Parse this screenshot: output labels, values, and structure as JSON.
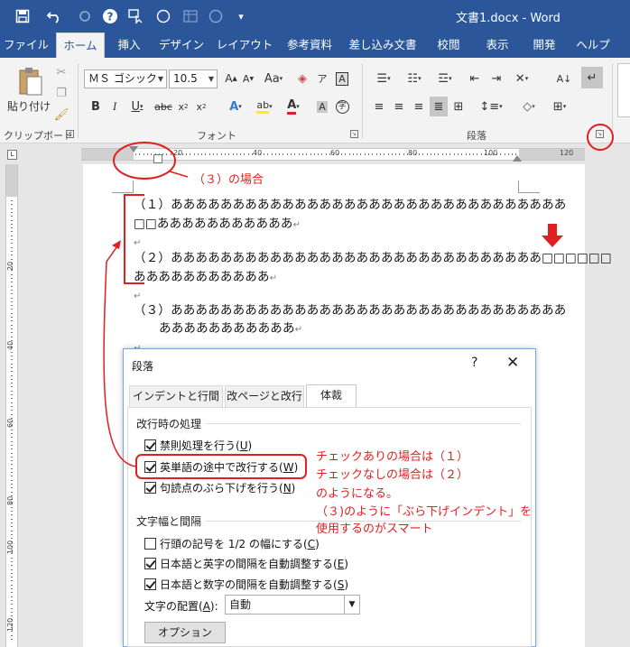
{
  "window": {
    "title": "文書1.docx  -  Word"
  },
  "quick_access": [
    {
      "name": "save-icon",
      "glyph": "🖫"
    },
    {
      "name": "undo-icon",
      "glyph": "↶"
    },
    {
      "name": "redo-icon",
      "glyph": "↻"
    },
    {
      "name": "help-icon",
      "glyph": "❓"
    },
    {
      "name": "touch-mode-icon",
      "glyph": "☝"
    },
    {
      "name": "circle-icon",
      "glyph": "○"
    },
    {
      "name": "table-icon",
      "glyph": "▦"
    },
    {
      "name": "circle-icon-2",
      "glyph": "○"
    },
    {
      "name": "customize-icon",
      "glyph": "▾"
    }
  ],
  "tabs": [
    "ファイル",
    "ホーム",
    "挿入",
    "デザイン",
    "レイアウト",
    "参考資料",
    "差し込み文書",
    "校閲",
    "表示",
    "開発",
    "ヘルプ"
  ],
  "ribbon": {
    "clipboard": {
      "label": "クリップボード",
      "paste": "貼り付け"
    },
    "font": {
      "label": "フォント",
      "font_name": "ＭＳ ゴシック",
      "font_size": "10.5"
    },
    "paragraph": {
      "label": "段落"
    }
  },
  "ruler": {
    "h_numbers": [
      "20",
      "40",
      "60",
      "80",
      "100",
      "120"
    ],
    "v_numbers": [
      "20",
      "40",
      "60",
      "80",
      "100",
      "120"
    ]
  },
  "document": {
    "p1_line1": "（１）ああああああああああああああああああああああああああああああああ",
    "p1_line2": "□□あああああああああああ",
    "p2_line1": "（２）ああああああああああああああああああああああああああああああ□□□□□□",
    "p2_line2": "あああああああああああ",
    "p3_line1": "（３）ああああああああああああああああああああああああああああああああ",
    "p3_line2": "あああああああああああ",
    "para_mark": "↵"
  },
  "dialog": {
    "title": "段落",
    "help": "?",
    "close": "✕",
    "tabs": [
      "インデントと行間隔",
      "改ページと改行",
      "体裁"
    ],
    "section1": "改行時の処理",
    "cb1": {
      "label": "禁則処理を行う(",
      "key": "U",
      "end": ")",
      "checked": true
    },
    "cb2": {
      "label": "英単語の途中で改行する(",
      "key": "W",
      "end": ")",
      "checked": true
    },
    "cb3": {
      "label": "句読点のぶら下げを行う(",
      "key": "N",
      "end": ")",
      "checked": true
    },
    "section2": "文字幅と間隔",
    "cb4": {
      "label": "行頭の記号を 1/2 の幅にする(",
      "key": "C",
      "end": ")",
      "checked": false
    },
    "cb5": {
      "label": "日本語と英字の間隔を自動調整する(",
      "key": "E",
      "end": ")",
      "checked": true
    },
    "cb6": {
      "label": "日本語と数字の間隔を自動調整する(",
      "key": "S",
      "end": ")",
      "checked": true
    },
    "align_label": "文字の配置(",
    "align_key": "A",
    "align_end": "):",
    "align_value": "自動",
    "options_button": "オプション(",
    "options_key": "O",
    "options_end": ")..."
  },
  "annotations": {
    "case3": "（３）の場合",
    "note1": "チェックありの場合は（１）",
    "note2": "チェックなしの場合は（２）",
    "note3": "のようになる。",
    "note4": "（３)のように「ぶら下げインデント」を",
    "note5": "使用するのがスマート"
  },
  "colors": {
    "word_blue": "#2b579a",
    "annotation_red": "#e02020"
  }
}
